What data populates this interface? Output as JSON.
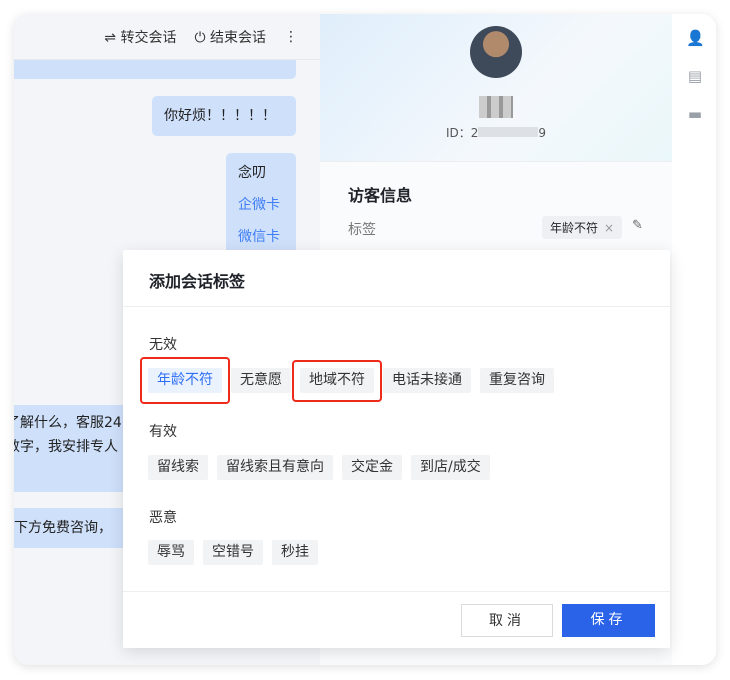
{
  "chat": {
    "header": {
      "transfer": "⇌ 转交会话",
      "end": "⏻ 结束会话",
      "more": "⋮"
    },
    "messages": [
      "你好烦！！！！！",
      "念叨",
      "企微卡",
      "微信卡"
    ],
    "left_messages": [
      "了解什么，客服24",
      "数字，我安排专人",
      "下方免费咨询，"
    ]
  },
  "visitor": {
    "id_label": "ID：2",
    "id_suffix": "9",
    "section_title": "访客信息",
    "tag_label": "标签",
    "tag": "年龄不符",
    "tag_remove": "×",
    "edit_icon": "pencil-icon"
  },
  "modal": {
    "title": "添加会话标签",
    "groups": [
      {
        "label": "无效",
        "tags": [
          "年龄不符",
          "无意愿",
          "地域不符",
          "电话未接通",
          "重复咨询"
        ]
      },
      {
        "label": "有效",
        "tags": [
          "留线索",
          "留线索且有意向",
          "交定金",
          "到店/成交"
        ]
      },
      {
        "label": "恶意",
        "tags": [
          "辱骂",
          "空错号",
          "秒挂"
        ]
      }
    ],
    "selected": "年龄不符",
    "cancel": "取消",
    "save": "保存"
  },
  "colors": {
    "accent": "#2a62e8",
    "highlight": "#ee2a1a"
  }
}
